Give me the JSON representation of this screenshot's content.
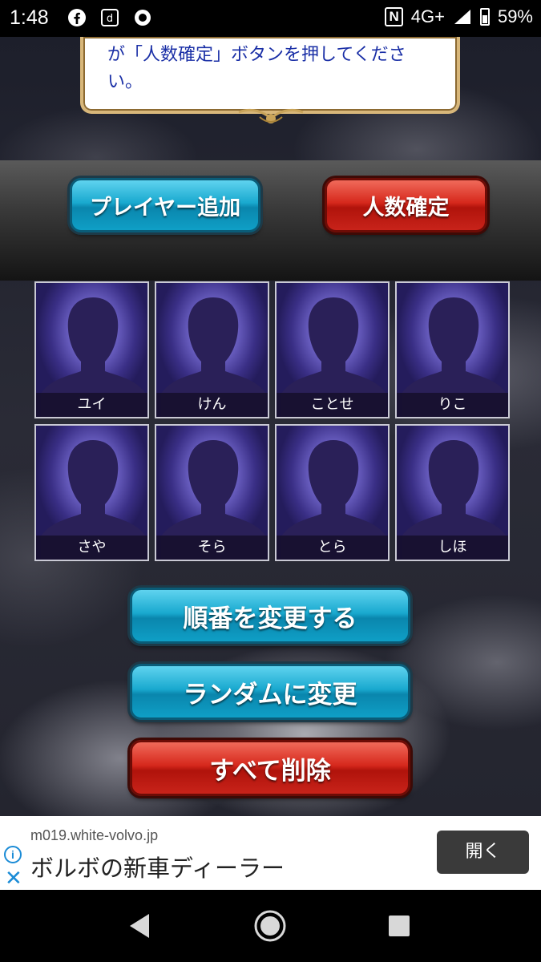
{
  "status_bar": {
    "time": "1:48",
    "network": "4G+",
    "battery": "59%",
    "icons": [
      "facebook-icon",
      "docomo-d-icon",
      "record-icon",
      "nfc-icon",
      "signal-icon",
      "battery-icon"
    ]
  },
  "message": {
    "text": "が「人数確定」ボタンを押してください。"
  },
  "toolbar": {
    "add_player_label": "プレイヤー追加",
    "confirm_count_label": "人数確定"
  },
  "players": [
    {
      "name": "ユイ"
    },
    {
      "name": "けん"
    },
    {
      "name": "ことせ"
    },
    {
      "name": "りこ"
    },
    {
      "name": "さや"
    },
    {
      "name": "そら"
    },
    {
      "name": "とら"
    },
    {
      "name": "しほ"
    }
  ],
  "actions": {
    "change_order_label": "順番を変更する",
    "randomize_label": "ランダムに変更",
    "delete_all_label": "すべて削除"
  },
  "ad": {
    "domain": "m019.white-volvo.jp",
    "title": "ボルボの新車ディーラー",
    "open_label": "開く"
  },
  "colors": {
    "blue_button": "#19a9cf",
    "red_button": "#d6281c",
    "message_text": "#1a2fa6",
    "card_purple": "#6d62c5"
  }
}
